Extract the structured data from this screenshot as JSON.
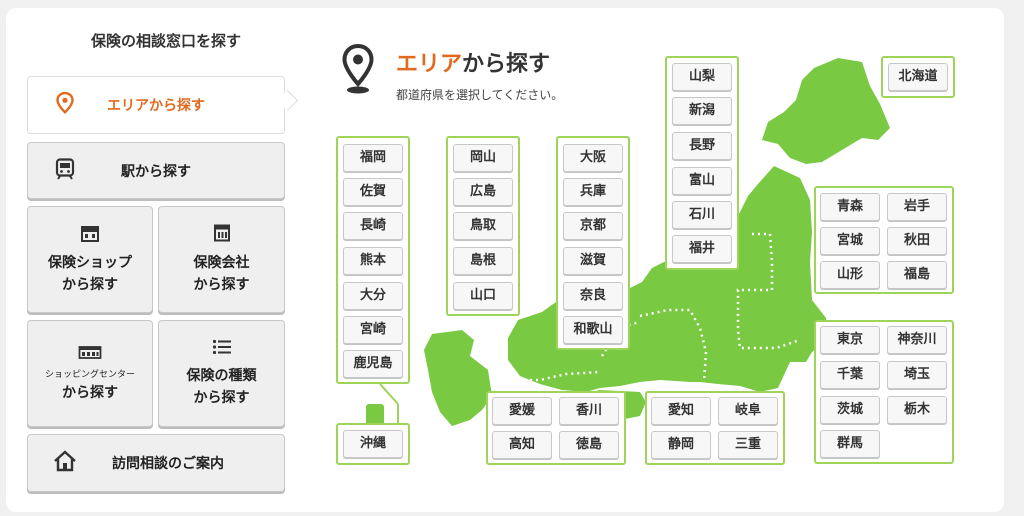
{
  "sidebar": {
    "title": "保険の相談窓口を探す",
    "area": "エリアから探す",
    "station": "駅から探す",
    "shop": [
      "保険ショップ",
      "から探す"
    ],
    "company": [
      "保険会社",
      "から探す"
    ],
    "mall_sub": "ショッピングセンター",
    "mall": "から探す",
    "kind": [
      "保険の種類",
      "から探す"
    ],
    "visit": "訪問相談のご案内"
  },
  "header": {
    "title_accent": "エリア",
    "title_rest": "から探す",
    "subtitle": "都道府県を選択してください。"
  },
  "colors": {
    "accent": "#e06a1f",
    "map_green": "#7ac943",
    "group_border": "#9ed45a"
  },
  "prefectures": {
    "kyushu": [
      "福岡",
      "佐賀",
      "長崎",
      "熊本",
      "大分",
      "宮崎",
      "鹿児島"
    ],
    "okinawa": [
      "沖縄"
    ],
    "chugoku": [
      "岡山",
      "広島",
      "鳥取",
      "島根",
      "山口"
    ],
    "kansai": [
      "大阪",
      "兵庫",
      "京都",
      "滋賀",
      "奈良",
      "和歌山"
    ],
    "shikoku": [
      "愛媛",
      "香川",
      "高知",
      "徳島"
    ],
    "chubu": [
      "山梨",
      "新潟",
      "長野",
      "富山",
      "石川",
      "福井"
    ],
    "tokai": [
      "愛知",
      "岐阜",
      "静岡",
      "三重"
    ],
    "hokkaido": [
      "北海道"
    ],
    "tohoku": [
      "青森",
      "岩手",
      "宮城",
      "秋田",
      "山形",
      "福島"
    ],
    "kanto": [
      "東京",
      "神奈川",
      "千葉",
      "埼玉",
      "茨城",
      "栃木",
      "群馬"
    ]
  }
}
